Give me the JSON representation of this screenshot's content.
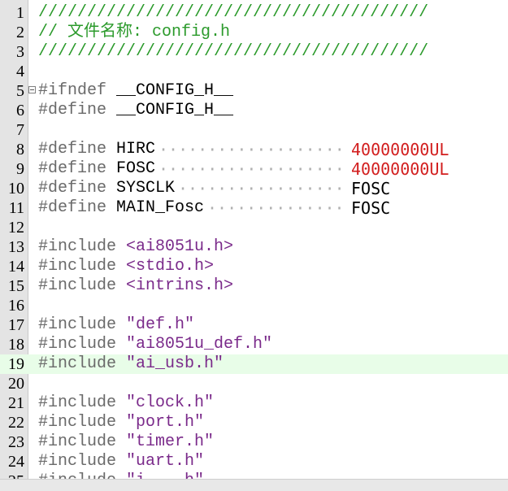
{
  "editor": {
    "current_line": 19,
    "lines": [
      {
        "n": "1",
        "tokens": [
          {
            "t": "////////////////////////////////////////",
            "c": "comment"
          }
        ]
      },
      {
        "n": "2",
        "tokens": [
          {
            "t": "// 文件名称: config.h",
            "c": "comment"
          }
        ]
      },
      {
        "n": "3",
        "tokens": [
          {
            "t": "////////////////////////////////////////",
            "c": "comment"
          }
        ]
      },
      {
        "n": "4",
        "tokens": []
      },
      {
        "n": "5",
        "fold": true,
        "tokens": [
          {
            "t": "#ifndef ",
            "c": "pre"
          },
          {
            "t": "__CONFIG_H__",
            "c": "macro"
          }
        ]
      },
      {
        "n": "6",
        "tokens": [
          {
            "t": "#define ",
            "c": "pre"
          },
          {
            "t": "__CONFIG_H__",
            "c": "macro"
          }
        ]
      },
      {
        "n": "7",
        "tokens": []
      },
      {
        "n": "8",
        "tokens": [
          {
            "t": "#define ",
            "c": "pre"
          },
          {
            "t": "HIRC",
            "c": "macro"
          }
        ],
        "value": {
          "t": "40000000UL",
          "c": "num"
        }
      },
      {
        "n": "9",
        "tokens": [
          {
            "t": "#define ",
            "c": "pre"
          },
          {
            "t": "FOSC",
            "c": "macro"
          }
        ],
        "value": {
          "t": "40000000UL",
          "c": "num"
        }
      },
      {
        "n": "10",
        "tokens": [
          {
            "t": "#define ",
            "c": "pre"
          },
          {
            "t": "SYSCLK",
            "c": "macro"
          }
        ],
        "value": {
          "t": "FOSC",
          "c": "val"
        }
      },
      {
        "n": "11",
        "tokens": [
          {
            "t": "#define ",
            "c": "pre"
          },
          {
            "t": "MAIN_Fosc",
            "c": "macro"
          }
        ],
        "value": {
          "t": "FOSC",
          "c": "val"
        }
      },
      {
        "n": "12",
        "tokens": []
      },
      {
        "n": "13",
        "tokens": [
          {
            "t": "#include ",
            "c": "pre"
          },
          {
            "t": "<ai8051u.h>",
            "c": "hdr"
          }
        ]
      },
      {
        "n": "14",
        "tokens": [
          {
            "t": "#include ",
            "c": "pre"
          },
          {
            "t": "<stdio.h>",
            "c": "hdr"
          }
        ]
      },
      {
        "n": "15",
        "tokens": [
          {
            "t": "#include ",
            "c": "pre"
          },
          {
            "t": "<intrins.h>",
            "c": "hdr"
          }
        ]
      },
      {
        "n": "16",
        "tokens": []
      },
      {
        "n": "17",
        "tokens": [
          {
            "t": "#include ",
            "c": "pre"
          },
          {
            "t": "\"def.h\"",
            "c": "str"
          }
        ]
      },
      {
        "n": "18",
        "tokens": [
          {
            "t": "#include ",
            "c": "pre"
          },
          {
            "t": "\"ai8051u_def.h\"",
            "c": "str"
          }
        ]
      },
      {
        "n": "19",
        "tokens": [
          {
            "t": "#include ",
            "c": "pre"
          },
          {
            "t": "\"ai_usb.h\"",
            "c": "str"
          }
        ]
      },
      {
        "n": "20",
        "tokens": []
      },
      {
        "n": "21",
        "tokens": [
          {
            "t": "#include ",
            "c": "pre"
          },
          {
            "t": "\"clock.h\"",
            "c": "str"
          }
        ]
      },
      {
        "n": "22",
        "tokens": [
          {
            "t": "#include ",
            "c": "pre"
          },
          {
            "t": "\"port.h\"",
            "c": "str"
          }
        ]
      },
      {
        "n": "23",
        "tokens": [
          {
            "t": "#include ",
            "c": "pre"
          },
          {
            "t": "\"timer.h\"",
            "c": "str"
          }
        ]
      },
      {
        "n": "24",
        "tokens": [
          {
            "t": "#include ",
            "c": "pre"
          },
          {
            "t": "\"uart.h\"",
            "c": "str"
          }
        ]
      },
      {
        "n": "25",
        "tokens": [
          {
            "t": "#include ",
            "c": "pre"
          },
          {
            "t": "\"i....h\"",
            "c": "str"
          }
        ]
      }
    ]
  },
  "colors": {
    "comment": "#2b9a2b",
    "preprocessor": "#6a6a6a",
    "string_header": "#7a2a8a",
    "number": "#d21e1e",
    "current_line_bg": "#e8fde8",
    "gutter_bg": "#e4e4e4"
  }
}
